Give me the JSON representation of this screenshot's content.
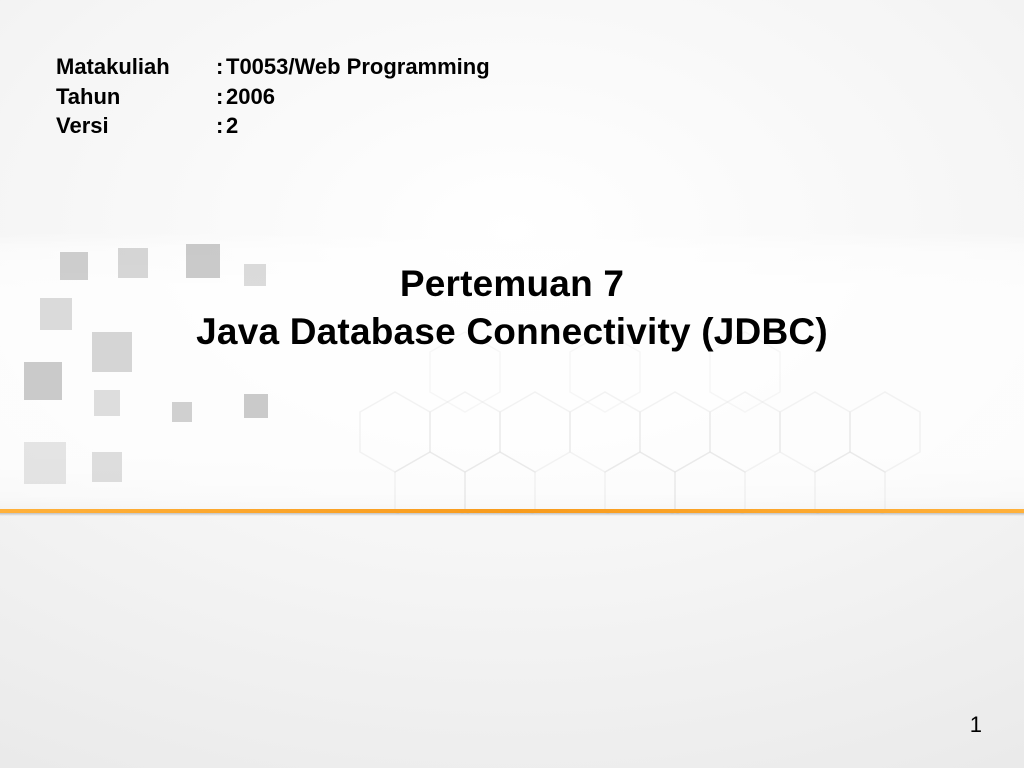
{
  "meta": {
    "rows": [
      {
        "label": "Matakuliah",
        "value": "T0053/Web Programming"
      },
      {
        "label": "Tahun",
        "value": "2006"
      },
      {
        "label": "Versi",
        "value": "2"
      }
    ]
  },
  "title": {
    "line1": "Pertemuan 7",
    "line2": "Java Database Connectivity (JDBC)"
  },
  "page_number": "1"
}
